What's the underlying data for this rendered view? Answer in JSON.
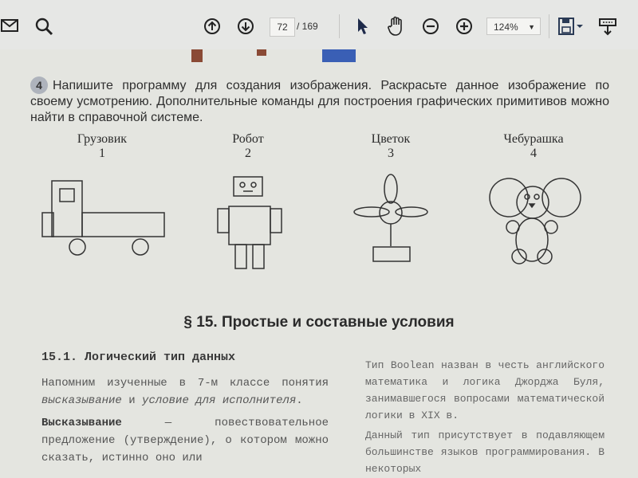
{
  "toolbar": {
    "icons": [
      "mail-icon",
      "zoom-search-icon",
      "page-up-icon",
      "page-down-icon",
      "select-cursor-icon",
      "hand-tool-icon",
      "zoom-out-icon",
      "zoom-in-icon",
      "save-icon",
      "download-icon"
    ],
    "page_current": "72",
    "page_total": "/ 169",
    "zoom": "124%"
  },
  "task": {
    "number": "4",
    "text": "Напишите программу для создания изображения. Раскрасьте данное изображение по своему усмотрению. Дополнительные команды для построения графических примитивов можно найти в справочной системе."
  },
  "figures": [
    {
      "name": "Грузовик",
      "num": "1"
    },
    {
      "name": "Робот",
      "num": "2"
    },
    {
      "name": "Цветок",
      "num": "3"
    },
    {
      "name": "Чебурашка",
      "num": "4"
    }
  ],
  "section": {
    "title": "§ 15. Простые и составные условия"
  },
  "left_col": {
    "subtitle": "15.1. Логический тип данных",
    "p1_a": "Напомним изученные в 7-м классе понятия ",
    "p1_b": "высказывание",
    "p1_c": " и ",
    "p1_d": "условие для исполнителя",
    "p1_e": ".",
    "p2_a": "Высказывание",
    "p2_b": " — повествовательное предложение (утверждение), о котором можно сказать, истинно оно или"
  },
  "right_col": {
    "p1": "Тип Boolean назван в честь английского математика и логика Джорджа Буля, занимавшегося вопросами математической логики в XIX в.",
    "p2": "Данный тип присутствует в подавляющем большинстве языков программирования. В некоторых"
  },
  "colors": {
    "accent_dark": "#2a3a55",
    "strip_brown": "#8a4a35",
    "strip_blue": "#3a5fb5"
  }
}
